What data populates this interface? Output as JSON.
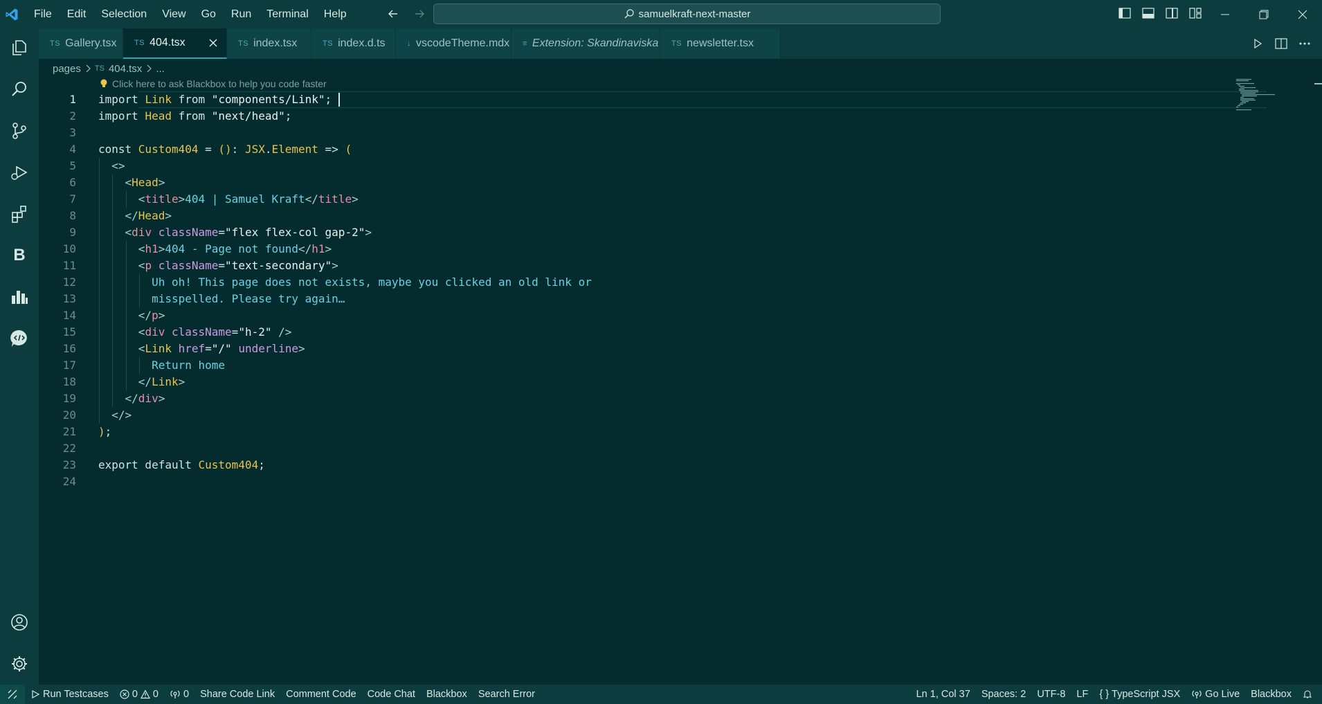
{
  "menu": [
    "File",
    "Edit",
    "Selection",
    "View",
    "Go",
    "Run",
    "Terminal",
    "Help"
  ],
  "command_center": {
    "label": "samuelkraft-next-master"
  },
  "tabs": [
    {
      "badge": "TS",
      "label": "Gallery.tsx",
      "active": false
    },
    {
      "badge": "TS",
      "label": "404.tsx",
      "active": true
    },
    {
      "badge": "TS",
      "label": "index.tsx",
      "active": false
    },
    {
      "badge": "TS",
      "label": "index.d.ts",
      "active": false
    },
    {
      "badge": "↓",
      "label": "vscodeTheme.mdx",
      "active": false
    },
    {
      "badge": "≡",
      "label": "Extension: Skandinaviska",
      "active": false
    },
    {
      "badge": "TS",
      "label": "newsletter.tsx",
      "active": false
    }
  ],
  "breadcrumb": {
    "folder": "pages",
    "badge": "TS",
    "file": "404.tsx",
    "more": "..."
  },
  "hint": "Click here to ask Blackbox to help you code faster",
  "code_lines": [
    [
      [
        "kw",
        "import "
      ],
      [
        "cn",
        "Link"
      ],
      [
        "kw",
        " from "
      ],
      [
        "str",
        "\"components/Link\""
      ],
      [
        "pun",
        ";"
      ]
    ],
    [
      [
        "kw",
        "import "
      ],
      [
        "cn",
        "Head"
      ],
      [
        "kw",
        " from "
      ],
      [
        "str",
        "\"next/head\""
      ],
      [
        "pun",
        ";"
      ]
    ],
    [],
    [
      [
        "kw",
        "const "
      ],
      [
        "cn",
        "Custom404"
      ],
      [
        "op",
        " = "
      ],
      [
        "br",
        "()"
      ],
      [
        "pun",
        ": "
      ],
      [
        "typ",
        "JSX"
      ],
      [
        "pun",
        "."
      ],
      [
        "typ",
        "Element"
      ],
      [
        "op",
        " => "
      ],
      [
        "br",
        "("
      ]
    ],
    [
      [
        "ang",
        "  <>"
      ]
    ],
    [
      [
        "ang",
        "    <"
      ],
      [
        "comp",
        "Head"
      ],
      [
        "ang",
        ">"
      ]
    ],
    [
      [
        "ang",
        "      <"
      ],
      [
        "tag",
        "title"
      ],
      [
        "ang",
        ">"
      ],
      [
        "txt",
        "404 | Samuel Kraft"
      ],
      [
        "ang",
        "</"
      ],
      [
        "tag",
        "title"
      ],
      [
        "ang",
        ">"
      ]
    ],
    [
      [
        "ang",
        "    </"
      ],
      [
        "comp",
        "Head"
      ],
      [
        "ang",
        ">"
      ]
    ],
    [
      [
        "ang",
        "    <"
      ],
      [
        "tag",
        "div"
      ],
      [
        "attr",
        " className"
      ],
      [
        "op",
        "="
      ],
      [
        "str",
        "\"flex flex-col gap-2\""
      ],
      [
        "ang",
        ">"
      ]
    ],
    [
      [
        "ang",
        "      <"
      ],
      [
        "tag",
        "h1"
      ],
      [
        "ang",
        ">"
      ],
      [
        "txt",
        "404 - Page not found"
      ],
      [
        "ang",
        "</"
      ],
      [
        "tag",
        "h1"
      ],
      [
        "ang",
        ">"
      ]
    ],
    [
      [
        "ang",
        "      <"
      ],
      [
        "tag",
        "p"
      ],
      [
        "attr",
        " className"
      ],
      [
        "op",
        "="
      ],
      [
        "str",
        "\"text-secondary\""
      ],
      [
        "ang",
        ">"
      ]
    ],
    [
      [
        "txt",
        "        Uh oh! This page does not exists, maybe you clicked an old link or"
      ]
    ],
    [
      [
        "txt",
        "        misspelled. Please try again…"
      ]
    ],
    [
      [
        "ang",
        "      </"
      ],
      [
        "tag",
        "p"
      ],
      [
        "ang",
        ">"
      ]
    ],
    [
      [
        "ang",
        "      <"
      ],
      [
        "tag",
        "div"
      ],
      [
        "attr",
        " className"
      ],
      [
        "op",
        "="
      ],
      [
        "str",
        "\"h-2\""
      ],
      [
        "ang",
        " />"
      ]
    ],
    [
      [
        "ang",
        "      <"
      ],
      [
        "comp",
        "Link"
      ],
      [
        "attr",
        " href"
      ],
      [
        "op",
        "="
      ],
      [
        "str",
        "\"/\""
      ],
      [
        "attr",
        " underline"
      ],
      [
        "ang",
        ">"
      ]
    ],
    [
      [
        "txt",
        "        Return home"
      ]
    ],
    [
      [
        "ang",
        "      </"
      ],
      [
        "comp",
        "Link"
      ],
      [
        "ang",
        ">"
      ]
    ],
    [
      [
        "ang",
        "    </"
      ],
      [
        "tag",
        "div"
      ],
      [
        "ang",
        ">"
      ]
    ],
    [
      [
        "ang",
        "  </>"
      ]
    ],
    [
      [
        "br",
        ")"
      ],
      [
        "pun",
        ";"
      ]
    ],
    [],
    [
      [
        "kw",
        "export default "
      ],
      [
        "cn",
        "Custom404"
      ],
      [
        "pun",
        ";"
      ]
    ],
    []
  ],
  "status": {
    "run_testcases": "Run Testcases",
    "problems_errors": "0",
    "problems_warnings": "0",
    "ports": "0",
    "share_code_link": "Share Code Link",
    "comment_code": "Comment Code",
    "code_chat": "Code Chat",
    "blackbox": "Blackbox",
    "search_error": "Search Error",
    "position": "Ln 1, Col 37",
    "spaces": "Spaces: 2",
    "encoding": "UTF-8",
    "eol": "LF",
    "language": "TypeScript JSX",
    "go_live": "Go Live",
    "blackbox_right": "Blackbox"
  },
  "colors": {
    "editor_bg": "#042c2f",
    "chrome_bg": "#0c3c3e",
    "keyword": "#d0e4e0",
    "identifier": "#e8c34e",
    "tag": "#e58fa8",
    "attribute": "#cc9ae0",
    "jsx_text": "#6cd1de",
    "accent": "#2aa7b5"
  },
  "icons": {
    "activity": [
      "explorer-icon",
      "search-icon",
      "source-control-icon",
      "run-debug-icon",
      "extensions-icon",
      "blackbox-b-icon",
      "chart-icon",
      "code-chat-icon",
      "account-icon",
      "settings-gear-icon"
    ]
  }
}
